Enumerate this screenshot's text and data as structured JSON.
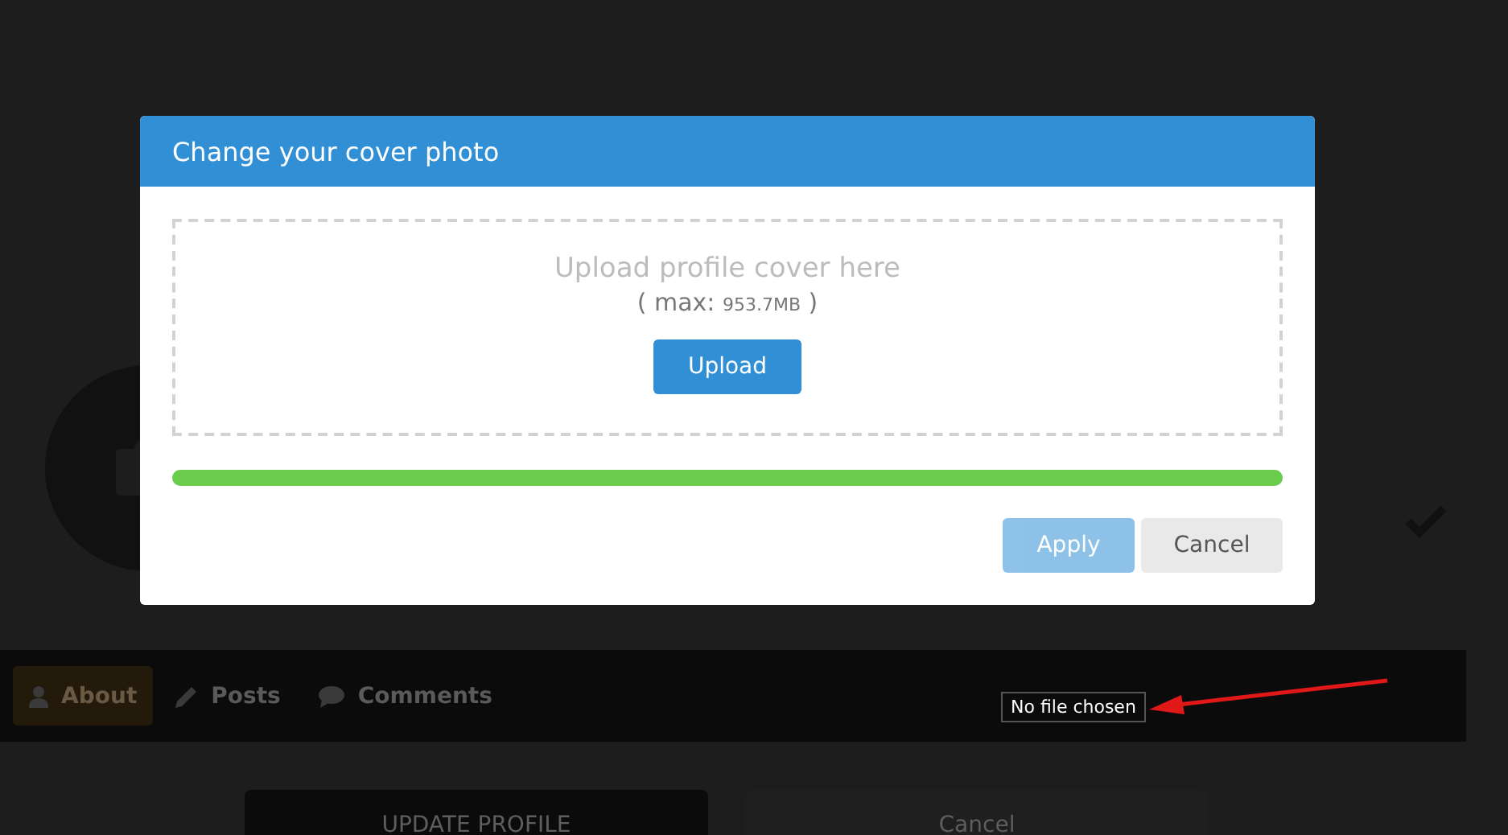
{
  "profile_nav": {
    "tabs": [
      {
        "label": "About",
        "selected": true
      },
      {
        "label": "Posts",
        "selected": false
      },
      {
        "label": "Comments",
        "selected": false
      }
    ]
  },
  "tooltip": "No file chosen",
  "profile_buttons": [
    "UPDATE PROFILE",
    "Cancel"
  ],
  "dialog": {
    "title": "Change your cover photo",
    "dropzone": {
      "text": "Upload profile cover here",
      "max_label": "( max:",
      "max_value": "953.7MB",
      "max_close": ")",
      "button": "Upload"
    },
    "progress": {
      "level": 1
    },
    "buttons": [
      {
        "label": "Apply",
        "kind": "primary",
        "disabled": true
      },
      {
        "label": "Cancel",
        "kind": "secondary",
        "disabled": false
      }
    ]
  }
}
